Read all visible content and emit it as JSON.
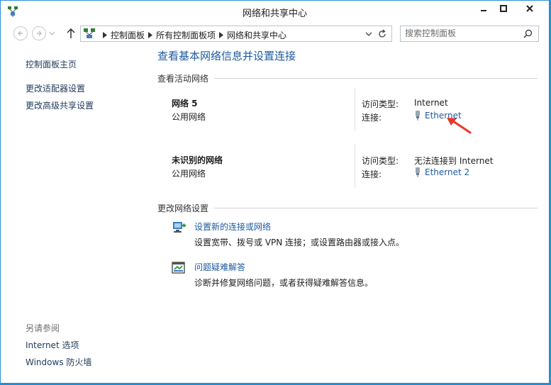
{
  "window": {
    "title": "网络和共享中心"
  },
  "address": {
    "breadcrumbs": [
      "控制面板",
      "所有控制面板项",
      "网络和共享中心"
    ]
  },
  "search": {
    "placeholder": "搜索控制面板"
  },
  "sidebar": {
    "links": [
      "控制面板主页",
      "更改适配器设置",
      "更改高级共享设置"
    ],
    "see_also_title": "另请参阅",
    "see_also_links": [
      "Internet 选项",
      "Windows 防火墙"
    ]
  },
  "main": {
    "title": "查看基本网络信息并设置连接",
    "active_networks_header": "查看活动网络",
    "networks": [
      {
        "name": "网络 5",
        "category": "公用网络",
        "access_label": "访问类型:",
        "access_value": "Internet",
        "connections_label": "连接:",
        "connection": "Ethernet"
      },
      {
        "name": "未识别的网络",
        "category": "公用网络",
        "access_label": "访问类型:",
        "access_value": "无法连接到 Internet",
        "connections_label": "连接:",
        "connection": "Ethernet 2"
      }
    ],
    "change_settings_header": "更改网络设置",
    "tasks": [
      {
        "link": "设置新的连接或网络",
        "desc": "设置宽带、拨号或 VPN 连接；或设置路由器或接入点。",
        "icon": "new-connection-icon"
      },
      {
        "link": "问题疑难解答",
        "desc": "诊断并修复网络问题，或者获得疑难解答信息。",
        "icon": "troubleshoot-icon"
      }
    ]
  },
  "colors": {
    "link": "#1e5aa0",
    "annotation_arrow": "#e8372a",
    "frame": "#2b8fd6"
  }
}
